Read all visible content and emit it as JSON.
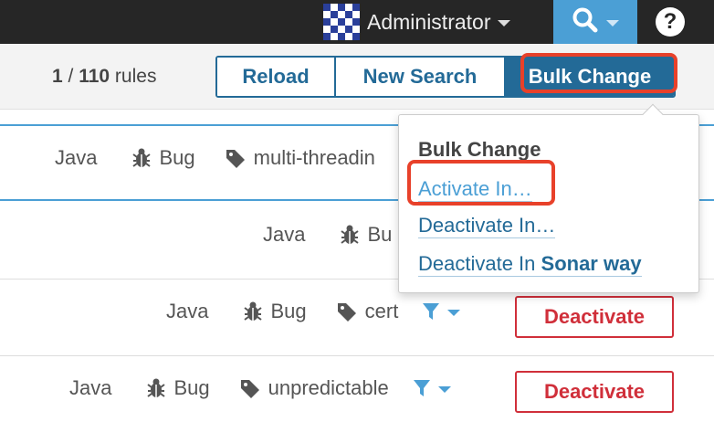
{
  "topbar": {
    "user_name": "Administrator",
    "colors": {
      "background": "#262626",
      "search_active": "#4b9fd5"
    },
    "icons": {
      "avatar": "avatar-icon",
      "search": "search-icon",
      "help": "help-icon"
    },
    "help_label": "?"
  },
  "toolbar": {
    "count_current": "1",
    "count_sep": " / ",
    "count_total": "110",
    "count_suffix": " rules",
    "reload_label": "Reload",
    "new_search_label": "New Search",
    "bulk_change_label": "Bulk Change"
  },
  "rules": [
    {
      "language": "Java",
      "type": "Bug",
      "tag": "multi-threadin",
      "selected": true
    },
    {
      "language": "Java",
      "type": "Bu",
      "tag": ""
    },
    {
      "language": "Java",
      "type": "Bug",
      "tag": "cert",
      "action": "Deactivate"
    },
    {
      "language": "Java",
      "type": "Bug",
      "tag": "unpredictable",
      "action": "Deactivate"
    }
  ],
  "dropdown": {
    "header": "Bulk Change",
    "items": [
      {
        "label": "Activate In…"
      },
      {
        "label": "Deactivate In…"
      },
      {
        "label": "Deactivate In ",
        "profile": "Sonar way"
      }
    ]
  },
  "colors": {
    "accent": "#236a97",
    "link_hover": "#4b9fd5",
    "danger": "#d02f3a",
    "highlight": "#e8412a"
  }
}
